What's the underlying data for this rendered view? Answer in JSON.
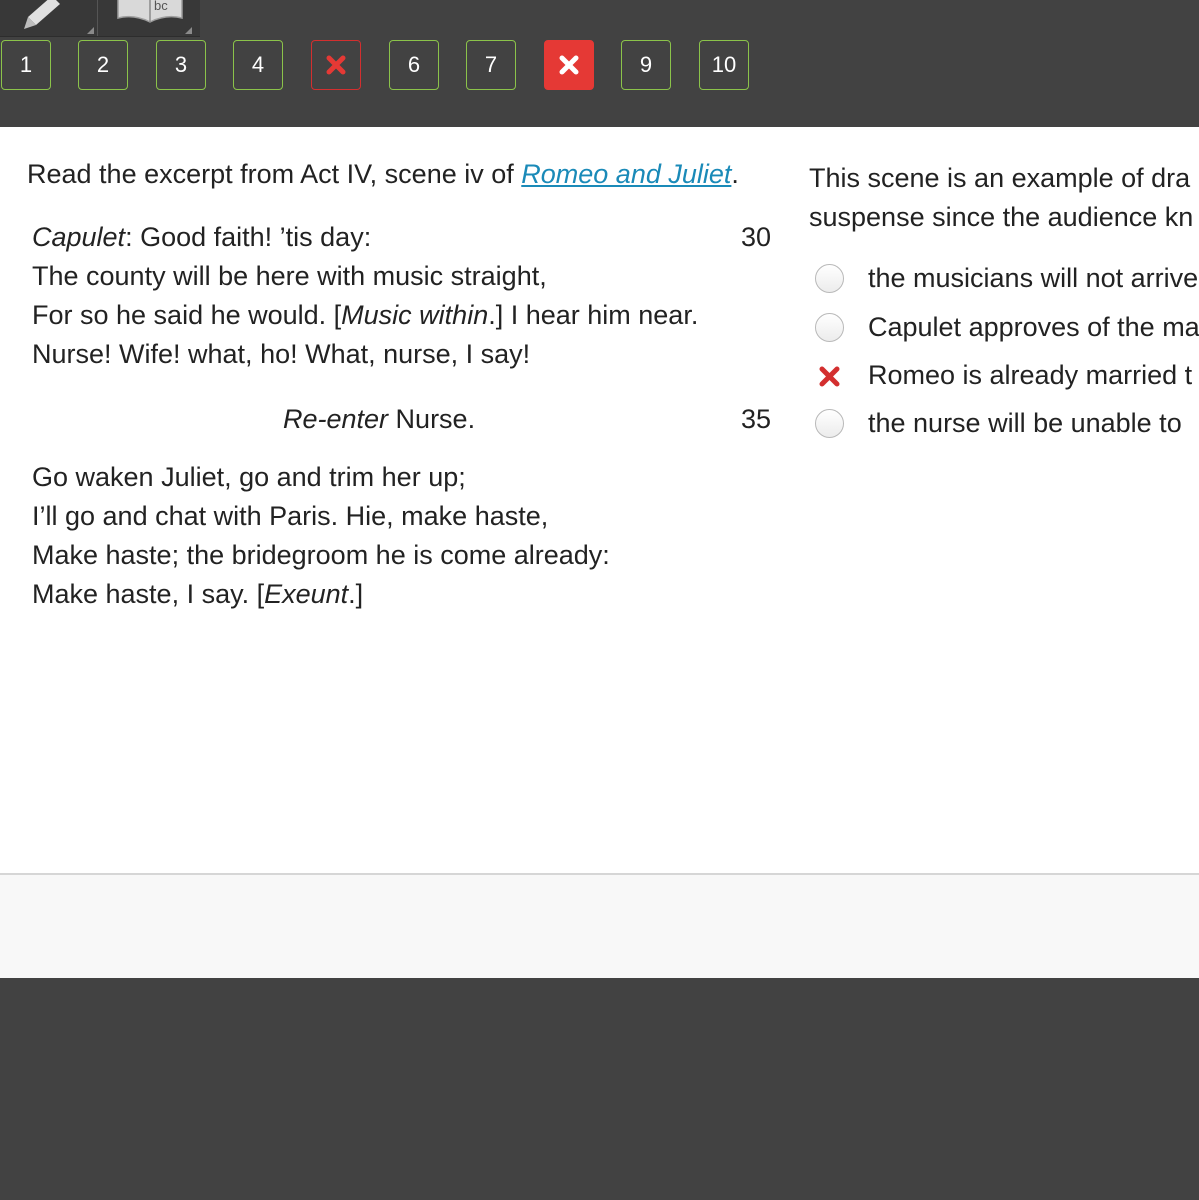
{
  "toolbar": {
    "tools": [
      {
        "name": "pencil",
        "icon": "pencil-icon"
      },
      {
        "name": "dictionary",
        "icon": "dictionary-book-icon"
      }
    ],
    "questions": [
      {
        "label": "1",
        "state": "normal"
      },
      {
        "label": "2",
        "state": "normal"
      },
      {
        "label": "3",
        "state": "normal"
      },
      {
        "label": "4",
        "state": "normal"
      },
      {
        "label": "",
        "state": "incorrect",
        "icon": "x-icon"
      },
      {
        "label": "6",
        "state": "normal"
      },
      {
        "label": "7",
        "state": "normal"
      },
      {
        "label": "",
        "state": "incorrect-current",
        "icon": "x-icon"
      },
      {
        "label": "9",
        "state": "normal"
      },
      {
        "label": "10",
        "state": "normal"
      }
    ],
    "colors": {
      "normal_border": "#8bc34a",
      "incorrect": "#e53935",
      "background": "#424242"
    }
  },
  "passage": {
    "prompt_prefix": "Read the excerpt from Act IV, scene iv of ",
    "prompt_link": "Romeo and Juliet",
    "prompt_suffix": ".",
    "line1_speaker": "Capulet",
    "line1_rest": ": Good faith! ’tis day:",
    "line1_number": "30",
    "line2": "The county will be here with music straight,",
    "line3_a": "For so he said he would. [",
    "line3_italic": "Music within",
    "line3_b": ".] I hear him near.",
    "line4": "Nurse! Wife! what, ho! What, nurse, I say!",
    "stage_italic": "Re-enter",
    "stage_rest": " Nurse.",
    "stage_number": "35",
    "line5": "Go waken Juliet, go and trim her up;",
    "line6": "I’ll go and chat with Paris. Hie, make haste,",
    "line7": "Make haste; the bridegroom he is come already:",
    "line8_a": "Make haste, I say. [",
    "line8_italic": "Exeunt",
    "line8_b": ".]"
  },
  "question": {
    "line1": "This scene is an example of dra",
    "line2": "suspense since the audience kn",
    "options": [
      {
        "text": "the musicians will not arrive",
        "state": "unselected"
      },
      {
        "text": "Capulet approves of the ma",
        "state": "unselected"
      },
      {
        "text": "Romeo is already married t",
        "state": "selected-incorrect",
        "icon": "x-icon"
      },
      {
        "text": "the nurse will be unable to",
        "state": "unselected"
      }
    ]
  }
}
